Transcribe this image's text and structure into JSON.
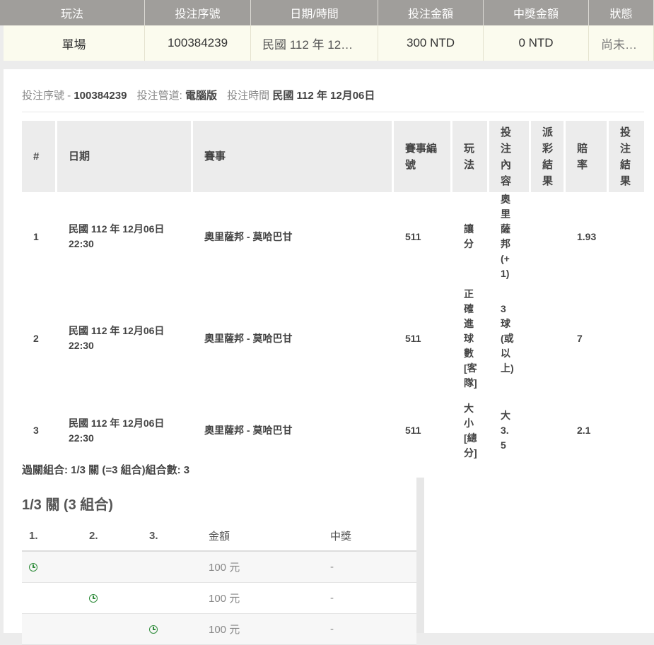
{
  "summary": {
    "headers": [
      "玩法",
      "投注序號",
      "日期/時間",
      "投注金額",
      "中獎金額",
      "狀態"
    ],
    "row": {
      "play_type": "單場",
      "bet_id": "100384239",
      "datetime": "民國 112 年 12…",
      "bet_amount": "300 NTD",
      "win_amount": "0 NTD",
      "status": "尚未…"
    }
  },
  "info": {
    "bet_id_label": "投注序號 -",
    "bet_id": "100384239",
    "channel_label": "投注管道:",
    "channel": "電腦版",
    "time_label": "投注時間",
    "time": "民國 112 年 12月06日"
  },
  "detail": {
    "headers": [
      "#",
      "日期",
      "賽事",
      "賽事編號",
      "玩法",
      "投注內容",
      "派彩結果",
      "賠率",
      "投注結果"
    ],
    "rows": [
      {
        "no": "1",
        "date": "民國 112 年 12月06日",
        "time": "22:30",
        "match": "奧里薩邦 - 莫哈巴甘",
        "match_no": "511",
        "play": "讓分",
        "content": "奧里薩邦(+1)",
        "payout": "",
        "odds": "1.93",
        "result": ""
      },
      {
        "no": "2",
        "date": "民國 112 年 12月06日",
        "time": "22:30",
        "match": "奧里薩邦 - 莫哈巴甘",
        "match_no": "511",
        "play": "正確進球數[客隊]",
        "content": "3球(或以上)",
        "payout": "",
        "odds": "7",
        "result": ""
      },
      {
        "no": "3",
        "date": "民國 112 年 12月06日",
        "time": "22:30",
        "match": "奧里薩邦 - 莫哈巴甘",
        "match_no": "511",
        "play": "大小[總分]",
        "content": "大3.5",
        "payout": "",
        "odds": "2.1",
        "result": ""
      }
    ]
  },
  "combo": {
    "summary_line": "過關組合: 1/3 關 (=3 組合)組合數: 3",
    "title": "1/3 關 (3 組合)",
    "headers": [
      "1.",
      "2.",
      "3.",
      "金額",
      "中獎"
    ],
    "rows": [
      {
        "amount": "100 元",
        "prize": "-"
      },
      {
        "amount": "100 元",
        "prize": "-"
      },
      {
        "amount": "100 元",
        "prize": "-"
      }
    ],
    "icon": "clock-icon",
    "icon_color": "#2e8b3a"
  }
}
